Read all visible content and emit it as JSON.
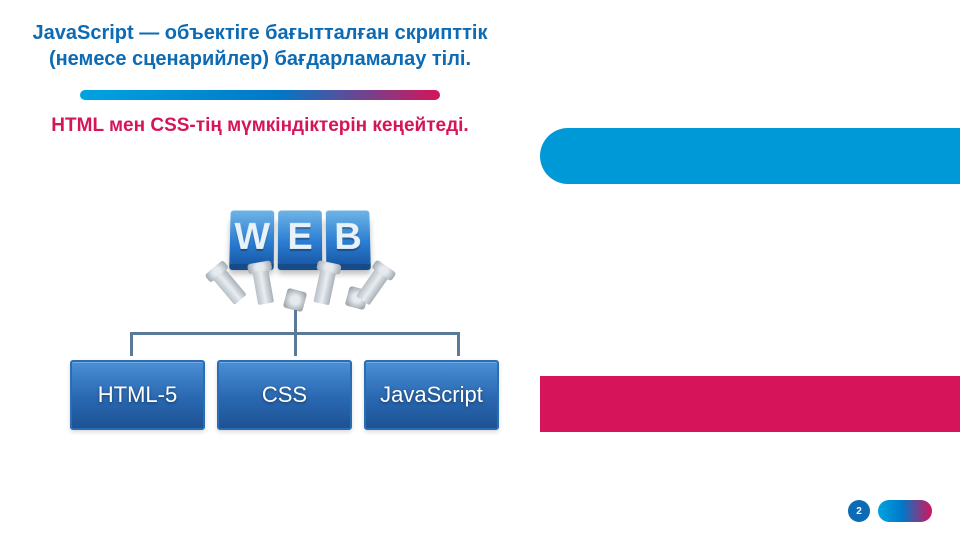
{
  "heading1": "JavaScript — объектіге бағытталған скрипттік (немесе сценарийлер) бағдарламалау тілі.",
  "heading2": "HTML мен CSS-тің мүмкіндіктерін кеңейтеді.",
  "web_label": "WEB",
  "tech": {
    "html": "HTML-5",
    "css": "CSS",
    "js": "JavaScript"
  },
  "page_number": "2",
  "colors": {
    "blue": "#0c6bb5",
    "pink": "#d5145a",
    "cyan": "#00a3e0"
  }
}
